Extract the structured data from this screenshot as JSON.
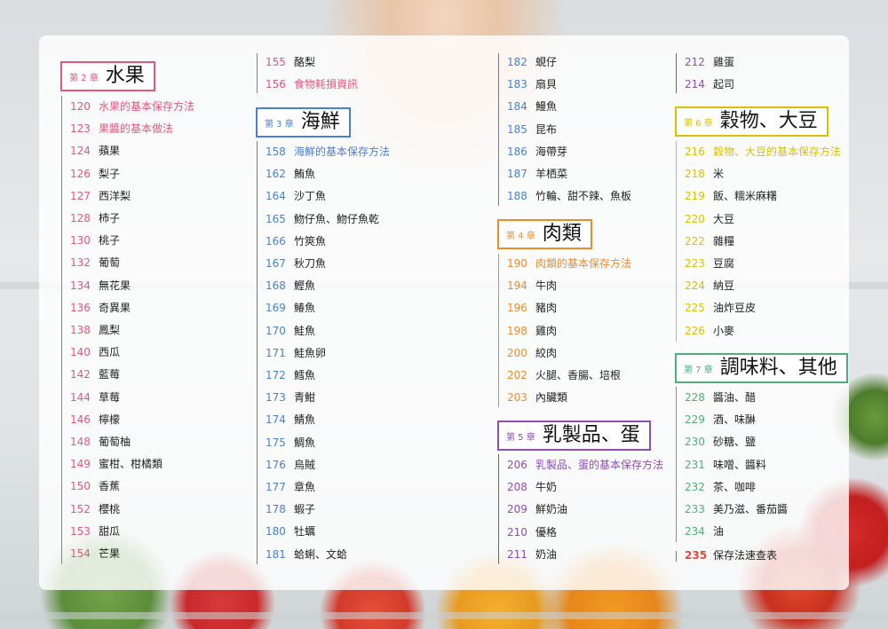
{
  "colors": {
    "ch2": "#e6557a",
    "ch3": "#4a7fd1",
    "ch4": "#ef8a2b",
    "ch5": "#8a4fb0",
    "ch6": "#d8c200",
    "ch7": "#4fae7a",
    "end": "#e04a3a"
  },
  "col1": {
    "chapter": {
      "label": "第 2 章",
      "title": "水果"
    },
    "entries": [
      {
        "page": "120",
        "text": "水果的基本保存方法"
      },
      {
        "page": "123",
        "text": "果醬的基本做法"
      },
      {
        "page": "124",
        "text": "蘋果"
      },
      {
        "page": "126",
        "text": "梨子"
      },
      {
        "page": "127",
        "text": "西洋梨"
      },
      {
        "page": "128",
        "text": "柿子"
      },
      {
        "page": "130",
        "text": "桃子"
      },
      {
        "page": "132",
        "text": "葡萄"
      },
      {
        "page": "134",
        "text": "無花果"
      },
      {
        "page": "136",
        "text": "奇異果"
      },
      {
        "page": "138",
        "text": "鳳梨"
      },
      {
        "page": "140",
        "text": "西瓜"
      },
      {
        "page": "142",
        "text": "藍莓"
      },
      {
        "page": "144",
        "text": "草莓"
      },
      {
        "page": "146",
        "text": "檸檬"
      },
      {
        "page": "148",
        "text": "葡萄柚"
      },
      {
        "page": "149",
        "text": "蜜柑、柑橘類"
      },
      {
        "page": "150",
        "text": "香蕉"
      },
      {
        "page": "152",
        "text": "櫻桃"
      },
      {
        "page": "153",
        "text": "甜瓜"
      },
      {
        "page": "154",
        "text": "芒果"
      }
    ]
  },
  "col2": {
    "top_entries": [
      {
        "page": "155",
        "text": "酪梨"
      },
      {
        "page": "156",
        "text": "食物耗損資訊"
      }
    ],
    "chapter": {
      "label": "第 3 章",
      "title": "海鮮"
    },
    "entries": [
      {
        "page": "158",
        "text": "海鮮的基本保存方法"
      },
      {
        "page": "162",
        "text": "鮪魚"
      },
      {
        "page": "164",
        "text": "沙丁魚"
      },
      {
        "page": "165",
        "text": "魩仔魚、魩仔魚乾"
      },
      {
        "page": "166",
        "text": "竹筴魚"
      },
      {
        "page": "167",
        "text": "秋刀魚"
      },
      {
        "page": "168",
        "text": "鰹魚"
      },
      {
        "page": "169",
        "text": "鰆魚"
      },
      {
        "page": "170",
        "text": "鮭魚"
      },
      {
        "page": "171",
        "text": "鮭魚卵"
      },
      {
        "page": "172",
        "text": "鱈魚"
      },
      {
        "page": "173",
        "text": "青魽"
      },
      {
        "page": "174",
        "text": "鯖魚"
      },
      {
        "page": "175",
        "text": "鯛魚"
      },
      {
        "page": "176",
        "text": "烏賊"
      },
      {
        "page": "177",
        "text": "章魚"
      },
      {
        "page": "178",
        "text": "蝦子"
      },
      {
        "page": "180",
        "text": "牡蠣"
      },
      {
        "page": "181",
        "text": "蛤蜊、文蛤"
      }
    ]
  },
  "col3": {
    "top_entries": [
      {
        "page": "182",
        "text": "蜆仔"
      },
      {
        "page": "183",
        "text": "扇貝"
      },
      {
        "page": "184",
        "text": "鰻魚"
      },
      {
        "page": "185",
        "text": "昆布"
      },
      {
        "page": "186",
        "text": "海帶芽"
      },
      {
        "page": "187",
        "text": "羊栖菜"
      },
      {
        "page": "188",
        "text": "竹輪、甜不辣、魚板"
      }
    ],
    "chapter4": {
      "label": "第 4 章",
      "title": "肉類"
    },
    "entries4": [
      {
        "page": "190",
        "text": "肉類的基本保存方法"
      },
      {
        "page": "194",
        "text": "牛肉"
      },
      {
        "page": "196",
        "text": "豬肉"
      },
      {
        "page": "198",
        "text": "雞肉"
      },
      {
        "page": "200",
        "text": "絞肉"
      },
      {
        "page": "202",
        "text": "火腿、香腸、培根"
      },
      {
        "page": "203",
        "text": "內臟類"
      }
    ],
    "chapter5": {
      "label": "第 5 章",
      "title": "乳製品、蛋"
    },
    "entries5": [
      {
        "page": "206",
        "text": "乳製品、蛋的基本保存方法"
      },
      {
        "page": "208",
        "text": "牛奶"
      },
      {
        "page": "209",
        "text": "鮮奶油"
      },
      {
        "page": "210",
        "text": "優格"
      },
      {
        "page": "211",
        "text": "奶油"
      }
    ]
  },
  "col4": {
    "top_entries": [
      {
        "page": "212",
        "text": "雞蛋"
      },
      {
        "page": "214",
        "text": "起司"
      }
    ],
    "chapter6": {
      "label": "第 6 章",
      "title": "穀物、大豆"
    },
    "entries6": [
      {
        "page": "216",
        "text": "穀物、大豆的基本保存方法"
      },
      {
        "page": "218",
        "text": "米"
      },
      {
        "page": "219",
        "text": "飯、糯米麻糬"
      },
      {
        "page": "220",
        "text": "大豆"
      },
      {
        "page": "222",
        "text": "雜糧"
      },
      {
        "page": "223",
        "text": "豆腐"
      },
      {
        "page": "224",
        "text": "納豆"
      },
      {
        "page": "225",
        "text": "油炸豆皮"
      },
      {
        "page": "226",
        "text": "小麥"
      }
    ],
    "chapter7": {
      "label": "第 7 章",
      "title": "調味料、其他"
    },
    "entries7": [
      {
        "page": "228",
        "text": "醬油、醋"
      },
      {
        "page": "229",
        "text": "酒、味醂"
      },
      {
        "page": "230",
        "text": "砂糖、鹽"
      },
      {
        "page": "231",
        "text": "味噌、醬料"
      },
      {
        "page": "232",
        "text": "茶、咖啡"
      },
      {
        "page": "233",
        "text": "美乃滋、番茄醬"
      },
      {
        "page": "234",
        "text": "油"
      }
    ],
    "final_entry": {
      "page": "235",
      "text": "保存法速查表"
    }
  }
}
